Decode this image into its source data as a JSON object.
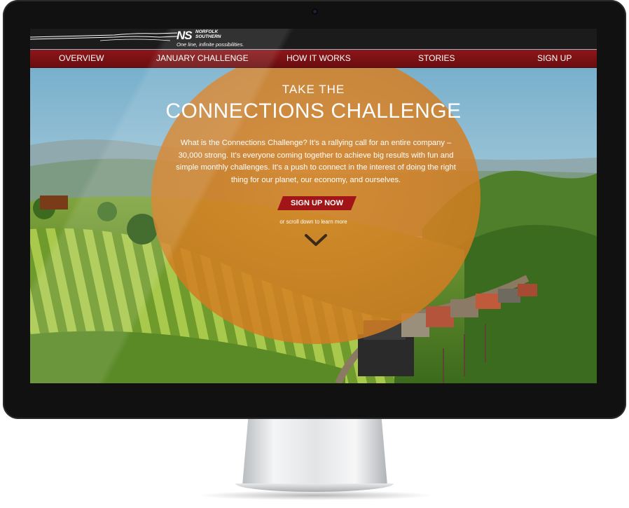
{
  "brand": {
    "logo_mark": "NS",
    "logo_name": "NORFOLK\nSOUTHERN",
    "tagline": "One line, infinite possibilities."
  },
  "nav": {
    "items": [
      {
        "label": "OVERVIEW"
      },
      {
        "label": "JANUARY CHALLENGE"
      },
      {
        "label": "HOW IT WORKS"
      },
      {
        "label": "STORIES"
      },
      {
        "label": "SIGN UP"
      }
    ]
  },
  "hero": {
    "kicker": "TAKE THE",
    "title": "CONNECTIONS CHALLENGE",
    "body": "What is the Connections Challenge? It’s a rallying call for an entire company – 30,000 strong. It’s everyone coming together to achieve big results with fun and simple monthly challenges. It’s a push to connect in the interest of doing the right thing for our planet, our economy, and ourselves.",
    "cta_label": "SIGN UP NOW",
    "scroll_hint": "or scroll down to learn more"
  },
  "colors": {
    "nav_bg": "#7a1013",
    "cta_bg": "#a11518",
    "circle": "#d9862a",
    "topbar": "#1b1b1b"
  },
  "icons": {
    "scroll": "chevron-down-icon",
    "camera": "camera-icon"
  }
}
